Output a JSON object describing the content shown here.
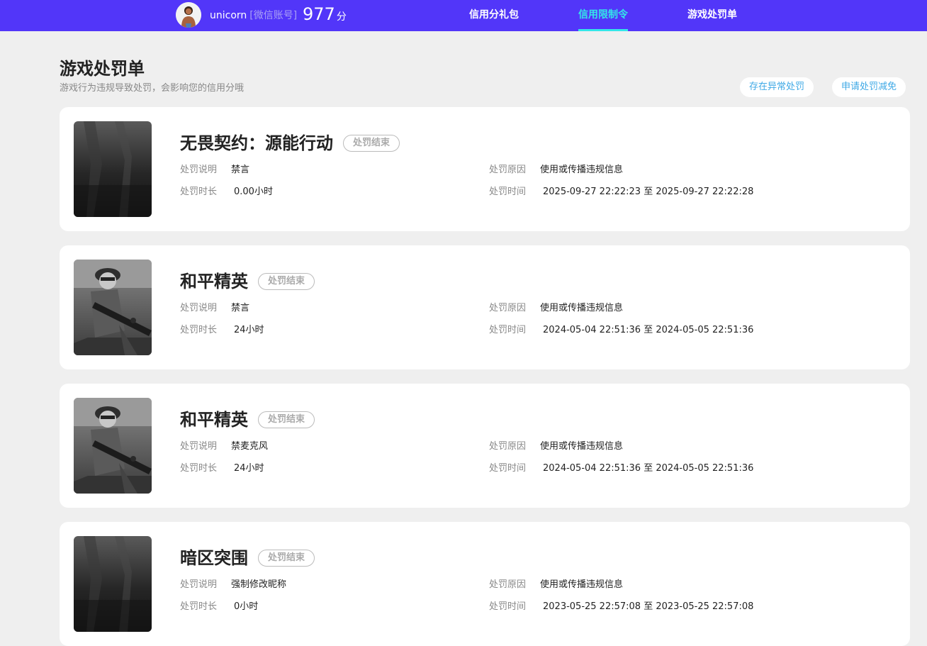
{
  "header": {
    "username": "unicorn",
    "account_type": "[微信账号]",
    "score": "977",
    "score_unit": "分",
    "tabs": [
      {
        "label": "信用分礼包",
        "active": false
      },
      {
        "label": "信用限制令",
        "active": true
      },
      {
        "label": "游戏处罚单",
        "active": false
      }
    ],
    "accent_color": "#5236f9",
    "active_tab_color": "#34e6e9"
  },
  "page": {
    "title": "游戏处罚单",
    "subtitle": "游戏行为违规导致处罚，会影响您的信用分哦",
    "buttons": {
      "abnormal": "存在异常处罚",
      "reduce": "申请处罚减免"
    }
  },
  "labels": {
    "desc": "处罚说明",
    "duration": "处罚时长",
    "reason": "处罚原因",
    "time": "处罚时间"
  },
  "records": [
    {
      "game": "无畏契约：源能行动",
      "status": "处罚结束",
      "desc": "禁言",
      "duration": "0.00小时",
      "reason": "使用或传播违规信息",
      "time": "2025-09-27 22:22:23 至 2025-09-27 22:22:28",
      "thumb_icon": "dark-game-art"
    },
    {
      "game": "和平精英",
      "status": "处罚结束",
      "desc": "禁言",
      "duration": "24小时",
      "reason": "使用或传播违规信息",
      "time": "2024-05-04 22:51:36 至 2024-05-05 22:51:36",
      "thumb_icon": "soldier-game-art"
    },
    {
      "game": "和平精英",
      "status": "处罚结束",
      "desc": "禁麦克风",
      "duration": "24小时",
      "reason": "使用或传播违规信息",
      "time": "2024-05-04 22:51:36 至 2024-05-05 22:51:36",
      "thumb_icon": "soldier-game-art"
    },
    {
      "game": "暗区突围",
      "status": "处罚结束",
      "desc": "强制修改昵称",
      "duration": "0小时",
      "reason": "使用或传播违规信息",
      "time": "2023-05-25 22:57:08 至 2023-05-25 22:57:08",
      "thumb_icon": "dark-game-art"
    }
  ]
}
